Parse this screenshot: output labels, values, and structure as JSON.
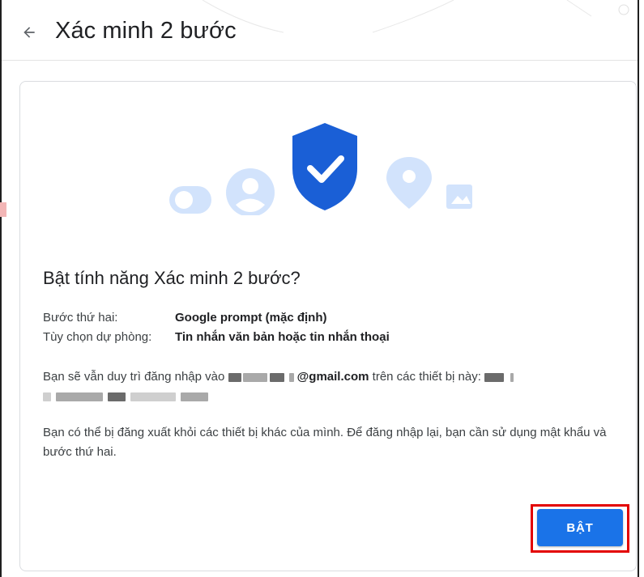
{
  "header": {
    "title": "Xác minh 2 bước",
    "back_icon": "arrow-left-icon"
  },
  "illustration": {
    "icons": [
      "toggle-icon",
      "account-icon",
      "shield-check-icon",
      "location-pin-icon",
      "image-icon"
    ],
    "accent_color": "#1a73e8",
    "light_color": "#d2e3fc"
  },
  "dialog": {
    "question": "Bật tính năng Xác minh 2 bước?",
    "rows": [
      {
        "label": "Bước thứ hai:",
        "value": "Google prompt (mặc định)"
      },
      {
        "label": "Tùy chọn dự phòng:",
        "value": "Tin nhắn văn bản hoặc tin nhắn thoại"
      }
    ],
    "para1_prefix": "Bạn sẽ vẫn duy trì đăng nhập vào",
    "email_suffix": "@gmail.com",
    "para1_suffix": "trên các thiết bị này:",
    "para2": "Bạn có thể bị đăng xuất khỏi các thiết bị khác của mình. Để đăng nhập lại, bạn cần sử dụng mật khẩu và bước thứ hai.",
    "button_label": "BẬT",
    "highlight_color": "#e30000"
  }
}
